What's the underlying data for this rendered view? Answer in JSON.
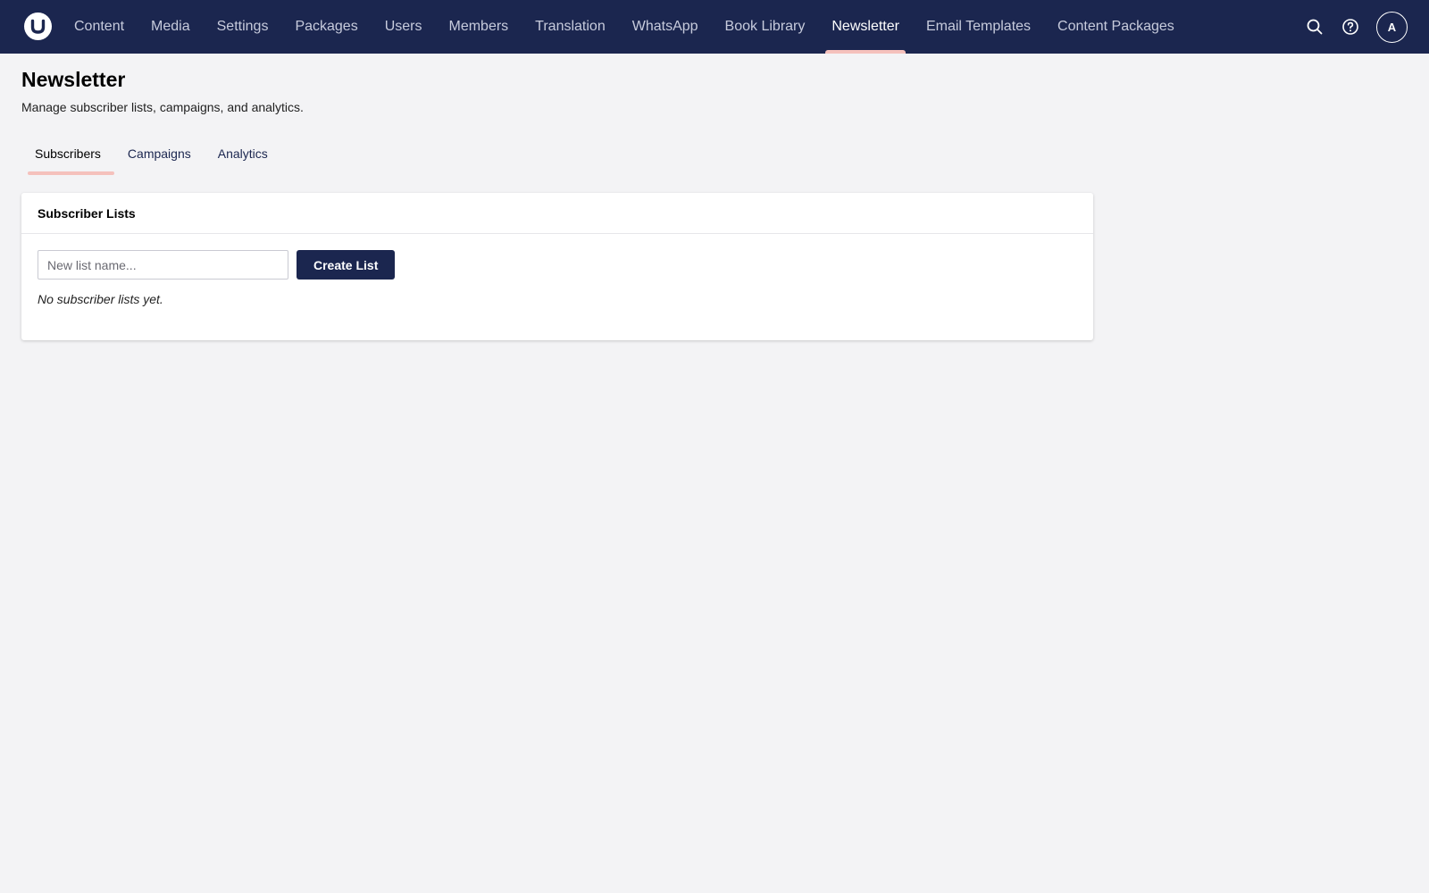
{
  "app": {
    "logo_icon": "umbraco-logo-icon"
  },
  "nav": {
    "items": [
      {
        "label": "Content",
        "active": false
      },
      {
        "label": "Media",
        "active": false
      },
      {
        "label": "Settings",
        "active": false
      },
      {
        "label": "Packages",
        "active": false
      },
      {
        "label": "Users",
        "active": false
      },
      {
        "label": "Members",
        "active": false
      },
      {
        "label": "Translation",
        "active": false
      },
      {
        "label": "WhatsApp",
        "active": false
      },
      {
        "label": "Book Library",
        "active": false
      },
      {
        "label": "Newsletter",
        "active": true
      },
      {
        "label": "Email Templates",
        "active": false
      },
      {
        "label": "Content Packages",
        "active": false
      }
    ]
  },
  "tools": {
    "search_icon": "search-icon",
    "help_icon": "help-icon",
    "avatar_initial": "A"
  },
  "page": {
    "title": "Newsletter",
    "subtitle": "Manage subscriber lists, campaigns, and analytics."
  },
  "tabs": [
    {
      "label": "Subscribers",
      "active": true
    },
    {
      "label": "Campaigns",
      "active": false
    },
    {
      "label": "Analytics",
      "active": false
    }
  ],
  "card": {
    "title": "Subscriber Lists",
    "input_placeholder": "New list name...",
    "input_value": "",
    "create_label": "Create List",
    "empty_text": "No subscriber lists yet."
  },
  "colors": {
    "header_bg": "#1b264f",
    "active_indicator": "#f5c1bc",
    "page_bg": "#f3f3f5",
    "primary_button": "#1b264f"
  }
}
